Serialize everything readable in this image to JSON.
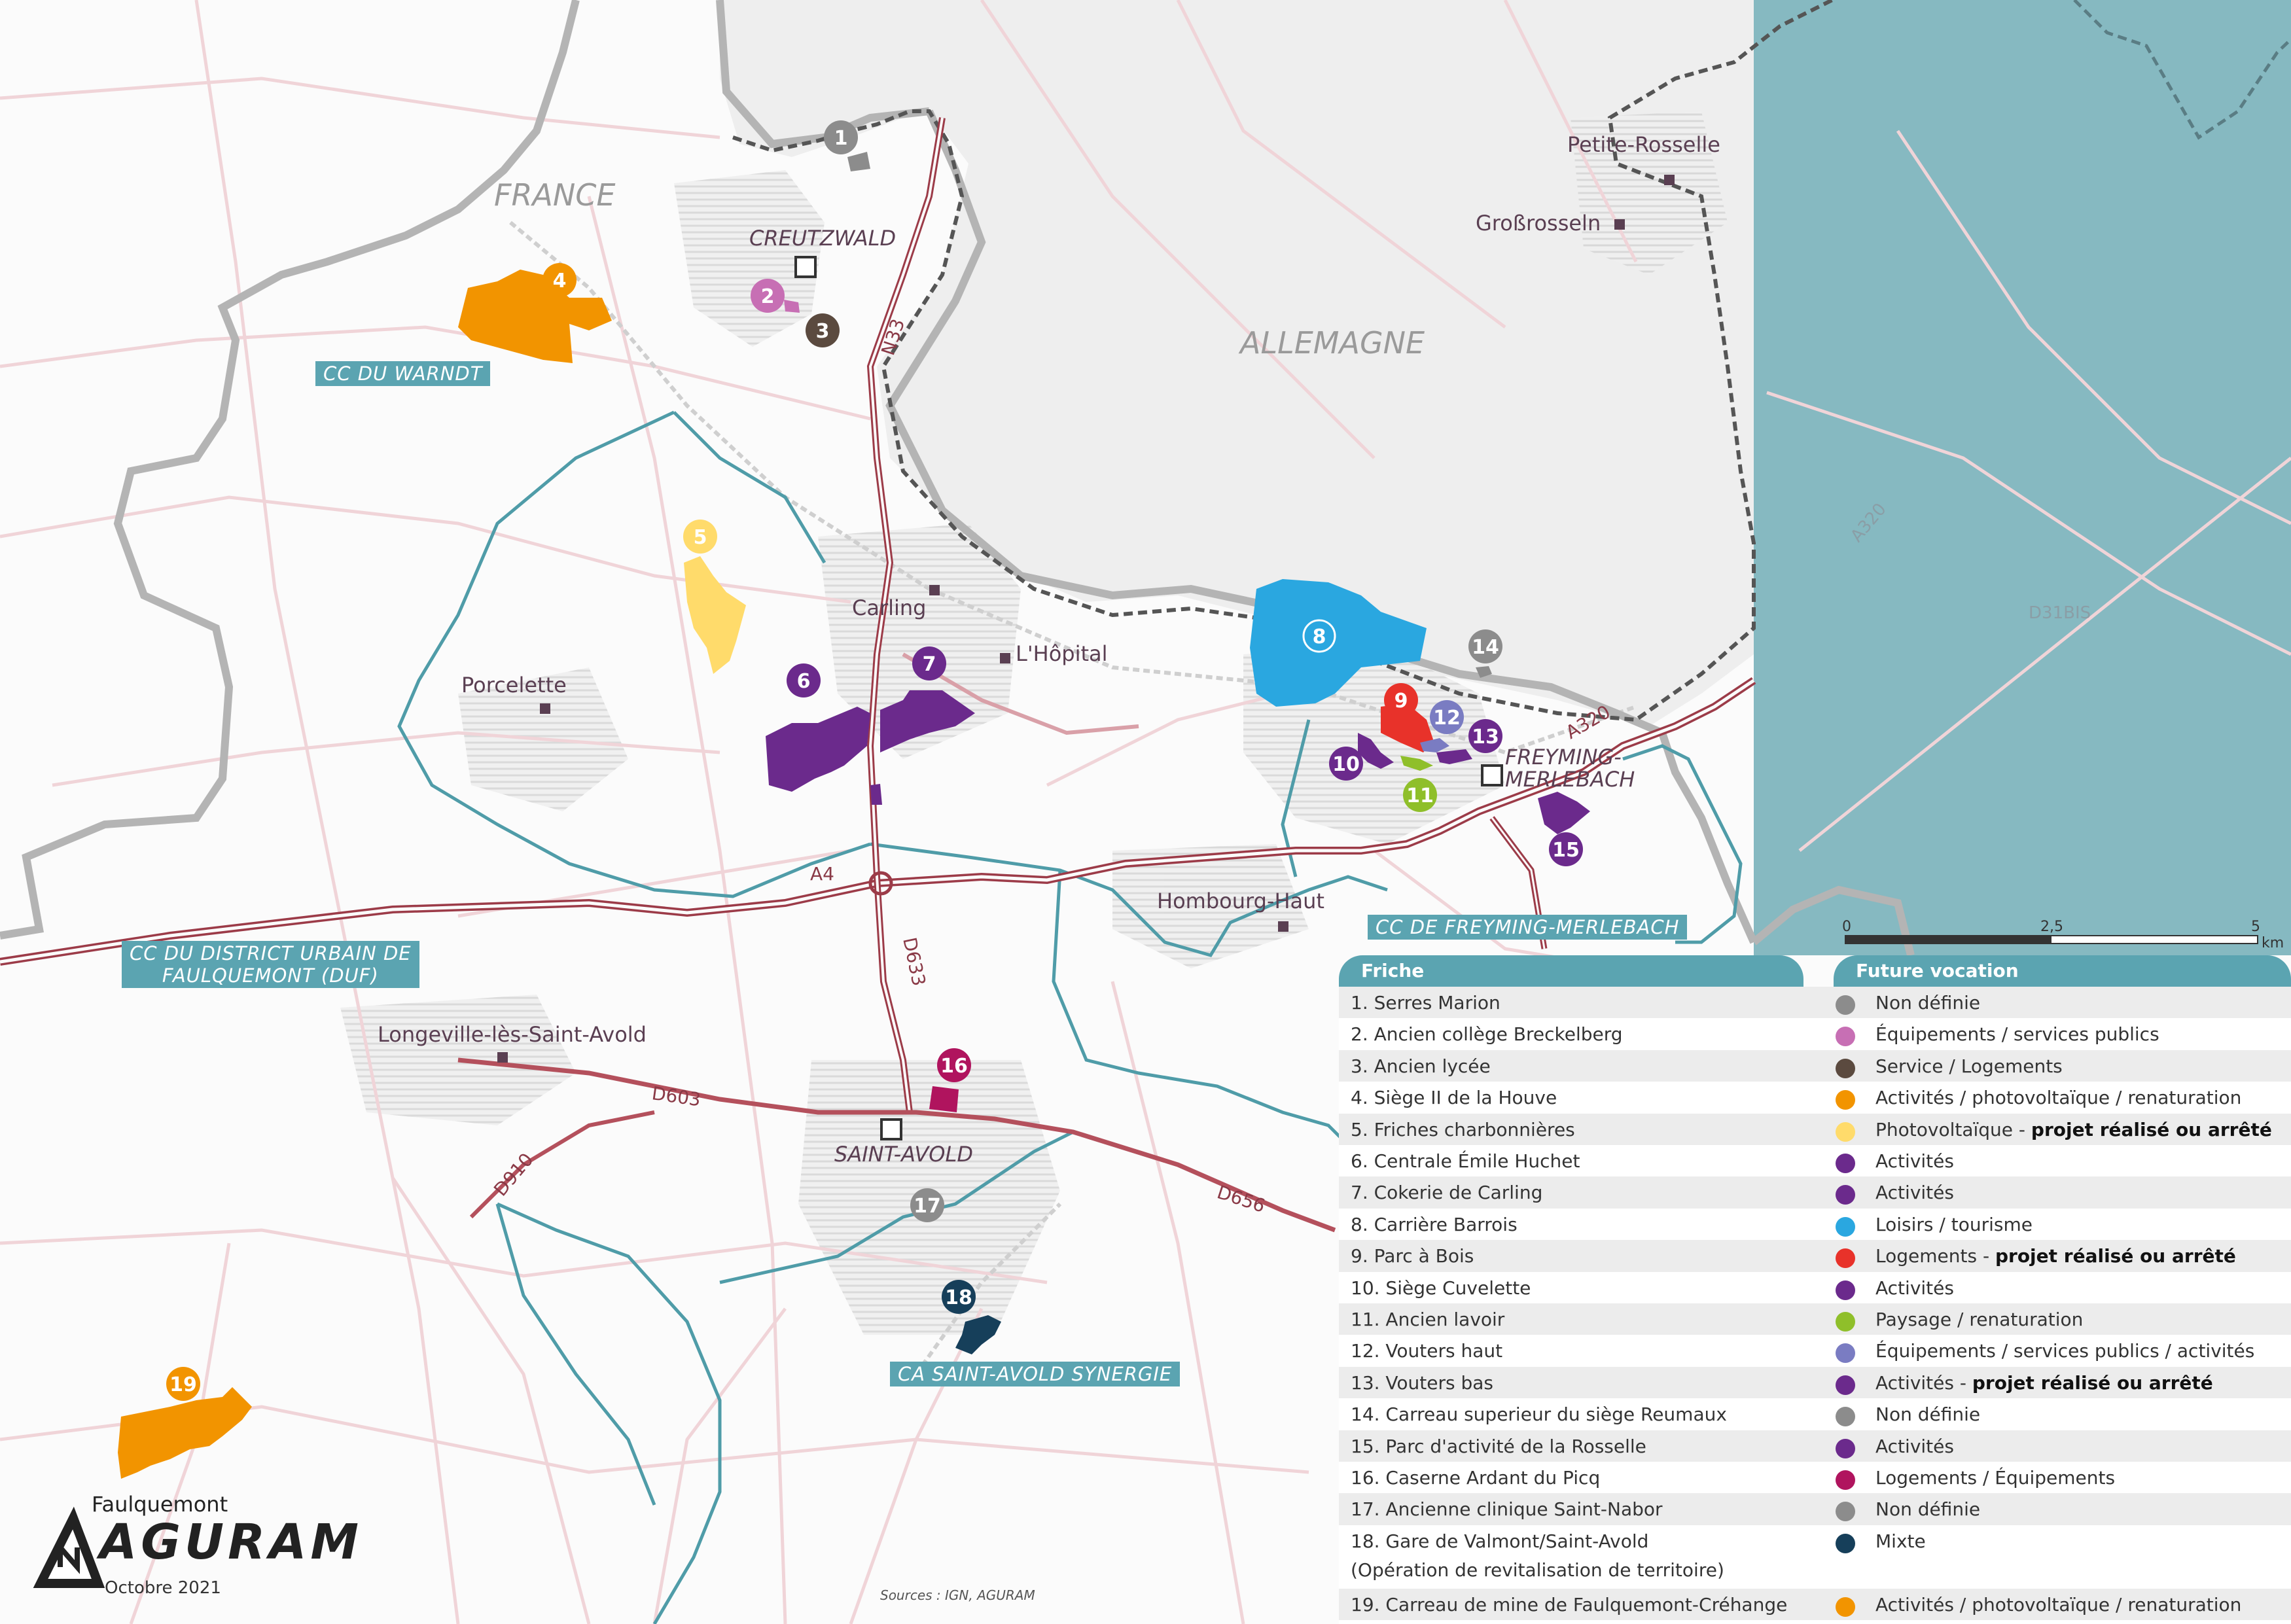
{
  "country_labels": {
    "france": "FRANCE",
    "germany": "ALLEMAGNE"
  },
  "communities": {
    "warndt": "CC DU WARNDT",
    "faulquemont_line1": "CC DU DISTRICT URBAIN DE",
    "faulquemont_line2": "FAULQUEMONT (DUF)",
    "freyming": "CC DE FREYMING-MERLEBACH",
    "saint_avold": "CA SAINT-AVOLD SYNERGIE"
  },
  "places": {
    "creutzwald": "CREUTZWALD",
    "petite_rosselle": "Petite-Rosselle",
    "grossrosseln": "Großrosseln",
    "carling": "Carling",
    "hopital": "L'Hôpital",
    "porcelette": "Porcelette",
    "freyming_line1": "FREYMING-",
    "freyming_line2": "MERLEBACH",
    "hombourg": "Hombourg-Haut",
    "longeville": "Longeville-lès-Saint-Avold",
    "saint_avold": "SAINT-AVOLD",
    "faulquemont": "Faulquemont"
  },
  "roads": {
    "n33": "N33",
    "a4": "A4",
    "d633": "D633",
    "d603": "D603",
    "d910": "D910",
    "d656": "D656",
    "a320": "A320",
    "a320_de": "A320",
    "d31bis": "D31BIS"
  },
  "scale": {
    "zero": "0",
    "mid": "2,5",
    "max": "5",
    "unit": "km"
  },
  "legend": {
    "friche_header": "Friche",
    "vocation_header": "Future vocation",
    "items": [
      {
        "name": "1. Serres Marion",
        "vocation": "Non définie",
        "bold": "",
        "color": "#8c8c8c"
      },
      {
        "name": "2. Ancien collège Breckelberg",
        "vocation": "Équipements / services publics",
        "bold": "",
        "color": "#c76fb4"
      },
      {
        "name": "3. Ancien lycée",
        "vocation": "Service / Logements",
        "bold": "",
        "color": "#5b4a3f"
      },
      {
        "name": "4. Siège II de la Houve",
        "vocation": "Activités / photovoltaïque / renaturation",
        "bold": "",
        "color": "#f29400"
      },
      {
        "name": "5. Friches charbonnières",
        "vocation": "Photovoltaïque - ",
        "bold": "projet réalisé ou arrêté",
        "color": "#ffdb6b"
      },
      {
        "name": "6. Centrale Émile Huchet",
        "vocation": "Activités",
        "bold": "",
        "color": "#6b2a8c"
      },
      {
        "name": "7. Cokerie de Carling",
        "vocation": "Activités",
        "bold": "",
        "color": "#6b2a8c"
      },
      {
        "name": "8. Carrière Barrois",
        "vocation": "Loisirs / tourisme",
        "bold": "",
        "color": "#2aa7e0"
      },
      {
        "name": "9. Parc à Bois",
        "vocation": "Logements - ",
        "bold": "projet réalisé ou arrêté",
        "color": "#e8322a"
      },
      {
        "name": "10. Siège Cuvelette",
        "vocation": "Activités",
        "bold": "",
        "color": "#6b2a8c"
      },
      {
        "name": "11. Ancien lavoir",
        "vocation": "Paysage / renaturation",
        "bold": "",
        "color": "#8fbf2a"
      },
      {
        "name": "12. Vouters haut",
        "vocation": "Équipements / services publics / activités",
        "bold": "",
        "color": "#7a7cc2"
      },
      {
        "name": "13. Vouters bas",
        "vocation": "Activités - ",
        "bold": "projet réalisé ou arrêté",
        "color": "#6b2a8c"
      },
      {
        "name": "14. Carreau superieur du siège Reumaux",
        "vocation": "Non définie",
        "bold": "",
        "color": "#8c8c8c"
      },
      {
        "name": "15. Parc d'activité de la Rosselle",
        "vocation": "Activités",
        "bold": "",
        "color": "#6b2a8c"
      },
      {
        "name": "16. Caserne Ardant du Picq",
        "vocation": "Logements / Équipements",
        "bold": "",
        "color": "#b0145e"
      },
      {
        "name": "17. Ancienne clinique Saint-Nabor",
        "vocation": "Non définie",
        "bold": "",
        "color": "#8c8c8c"
      },
      {
        "name": "18.  Gare de Valmont/Saint-Avold",
        "sub": "(Opération de revitalisation de territoire)",
        "vocation": "Mixte",
        "bold": "",
        "color": "#163f5a"
      },
      {
        "name": "19.  Carreau de mine de Faulquemont-Créhange",
        "vocation": "Activités / photovoltaïque / renaturation",
        "bold": "",
        "color": "#f29400"
      }
    ]
  },
  "sites": [
    {
      "id": "1",
      "color": "#8c8c8c"
    },
    {
      "id": "2",
      "color": "#c76fb4"
    },
    {
      "id": "3",
      "color": "#5b4a3f"
    },
    {
      "id": "4",
      "color": "#f29400"
    },
    {
      "id": "5",
      "color": "#ffdb6b"
    },
    {
      "id": "6",
      "color": "#6b2a8c"
    },
    {
      "id": "7",
      "color": "#6b2a8c"
    },
    {
      "id": "8",
      "color": "#2aa7e0"
    },
    {
      "id": "9",
      "color": "#e8322a"
    },
    {
      "id": "10",
      "color": "#6b2a8c"
    },
    {
      "id": "11",
      "color": "#8fbf2a"
    },
    {
      "id": "12",
      "color": "#7a7cc2"
    },
    {
      "id": "13",
      "color": "#6b2a8c"
    },
    {
      "id": "14",
      "color": "#8c8c8c"
    },
    {
      "id": "15",
      "color": "#6b2a8c"
    },
    {
      "id": "16",
      "color": "#b0145e"
    },
    {
      "id": "17",
      "color": "#8c8c8c"
    },
    {
      "id": "18",
      "color": "#163f5a"
    },
    {
      "id": "19",
      "color": "#f29400"
    }
  ],
  "brand": {
    "name": "AGURAM",
    "date": "Octobre 2021"
  },
  "sources": "Sources : IGN, AGURAM"
}
